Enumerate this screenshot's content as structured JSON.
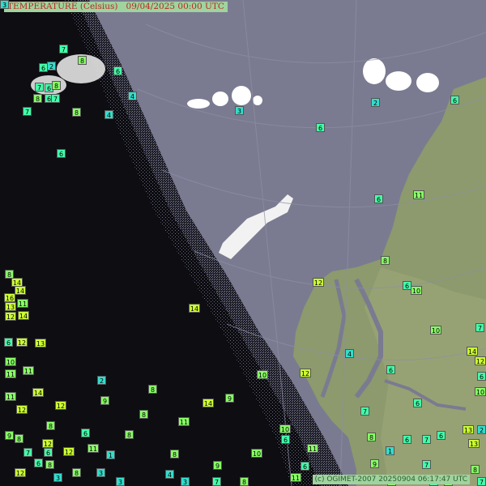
{
  "header": {
    "title": "TEMPERATURE (Celsius)",
    "date": "09/04/2025 00:00 UTC"
  },
  "credit": "(c) OGIMET-2007 20250904 06:17:47 UTC",
  "colors": {
    "sea": "#7a7b91",
    "land": "#8c9a6d",
    "ice": "#ffffff",
    "label_warm": "#ccff33",
    "label_mild": "#88ff66",
    "label_cool": "#44ffaa",
    "label_cold": "#33ddcc"
  },
  "observations": [
    {
      "v": "7"
    },
    {
      "v": "6"
    },
    {
      "v": "2"
    },
    {
      "v": "8"
    },
    {
      "v": "6"
    },
    {
      "v": "7"
    },
    {
      "v": "4"
    },
    {
      "v": "6"
    },
    {
      "v": "8"
    },
    {
      "v": "6"
    },
    {
      "v": "7"
    },
    {
      "v": "8"
    },
    {
      "v": "7"
    },
    {
      "v": "8"
    },
    {
      "v": "4"
    },
    {
      "v": "6"
    },
    {
      "v": "3"
    },
    {
      "v": "6"
    },
    {
      "v": "2"
    },
    {
      "v": "6"
    },
    {
      "v": "6"
    },
    {
      "v": "6"
    },
    {
      "v": "11"
    },
    {
      "v": "8"
    },
    {
      "v": "12"
    },
    {
      "v": "10"
    },
    {
      "v": "8"
    },
    {
      "v": "14"
    },
    {
      "v": "14"
    },
    {
      "v": "16"
    },
    {
      "v": "13"
    },
    {
      "v": "11"
    },
    {
      "v": "12"
    },
    {
      "v": "14"
    },
    {
      "v": "14"
    },
    {
      "v": "10"
    },
    {
      "v": "7"
    },
    {
      "v": "6"
    },
    {
      "v": "12"
    },
    {
      "v": "13"
    },
    {
      "v": "14"
    },
    {
      "v": "4"
    },
    {
      "v": "10"
    },
    {
      "v": "12"
    },
    {
      "v": "11"
    },
    {
      "v": "11"
    },
    {
      "v": "12"
    },
    {
      "v": "6"
    },
    {
      "v": "10"
    },
    {
      "v": "6"
    },
    {
      "v": "2"
    },
    {
      "v": "8"
    },
    {
      "v": "11"
    },
    {
      "v": "14"
    },
    {
      "v": "9"
    },
    {
      "v": "12"
    },
    {
      "v": "9"
    },
    {
      "v": "14"
    },
    {
      "v": "6"
    },
    {
      "v": "12"
    },
    {
      "v": "7"
    },
    {
      "v": "8"
    },
    {
      "v": "11"
    },
    {
      "v": "8"
    },
    {
      "v": "10"
    },
    {
      "v": "6"
    },
    {
      "v": "13"
    },
    {
      "v": "8"
    },
    {
      "v": "9"
    },
    {
      "v": "8"
    },
    {
      "v": "8"
    },
    {
      "v": "6"
    },
    {
      "v": "12"
    },
    {
      "v": "6"
    },
    {
      "v": "7"
    },
    {
      "v": "13"
    },
    {
      "v": "7"
    },
    {
      "v": "6"
    },
    {
      "v": "11"
    },
    {
      "v": "12"
    },
    {
      "v": "11"
    },
    {
      "v": "1"
    },
    {
      "v": "8"
    },
    {
      "v": "1"
    },
    {
      "v": "6"
    },
    {
      "v": "8"
    },
    {
      "v": "9"
    },
    {
      "v": "7"
    },
    {
      "v": "10"
    },
    {
      "v": "12"
    },
    {
      "v": "6"
    },
    {
      "v": "3"
    },
    {
      "v": "8"
    },
    {
      "v": "3"
    },
    {
      "v": "4"
    },
    {
      "v": "3"
    },
    {
      "v": "3"
    },
    {
      "v": "7"
    },
    {
      "v": "8"
    },
    {
      "v": "11"
    },
    {
      "v": "11"
    },
    {
      "v": "9"
    },
    {
      "v": "8"
    },
    {
      "v": "9"
    },
    {
      "v": "6"
    },
    {
      "v": "8"
    },
    {
      "v": "7"
    },
    {
      "v": "10"
    },
    {
      "v": "2"
    },
    {
      "v": "6"
    },
    {
      "v": "4"
    },
    {
      "v": "3"
    }
  ]
}
